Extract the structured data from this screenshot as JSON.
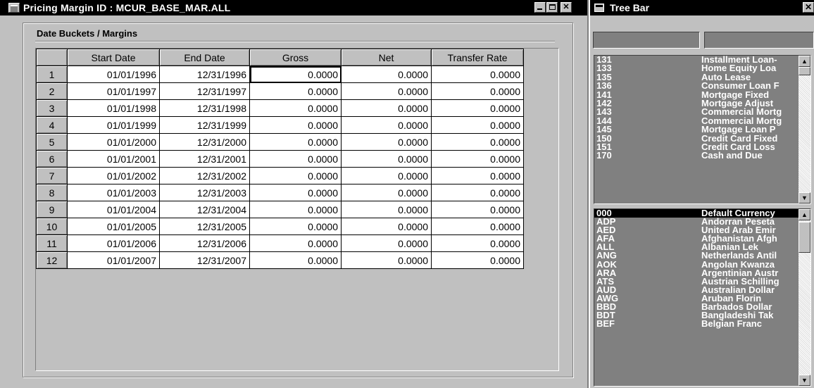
{
  "main_window": {
    "title": "Pricing Margin ID : MCUR_BASE_MAR.ALL",
    "group_label": "Date Buckets / Margins",
    "columns": [
      "",
      "Start Date",
      "End Date",
      "Gross",
      "Net",
      "Transfer Rate"
    ],
    "rows": [
      {
        "num": "1",
        "start": "01/01/1996",
        "end": "12/31/1996",
        "gross": "0.0000",
        "net": "0.0000",
        "rate": "0.0000"
      },
      {
        "num": "2",
        "start": "01/01/1997",
        "end": "12/31/1997",
        "gross": "0.0000",
        "net": "0.0000",
        "rate": "0.0000"
      },
      {
        "num": "3",
        "start": "01/01/1998",
        "end": "12/31/1998",
        "gross": "0.0000",
        "net": "0.0000",
        "rate": "0.0000"
      },
      {
        "num": "4",
        "start": "01/01/1999",
        "end": "12/31/1999",
        "gross": "0.0000",
        "net": "0.0000",
        "rate": "0.0000"
      },
      {
        "num": "5",
        "start": "01/01/2000",
        "end": "12/31/2000",
        "gross": "0.0000",
        "net": "0.0000",
        "rate": "0.0000"
      },
      {
        "num": "6",
        "start": "01/01/2001",
        "end": "12/31/2001",
        "gross": "0.0000",
        "net": "0.0000",
        "rate": "0.0000"
      },
      {
        "num": "7",
        "start": "01/01/2002",
        "end": "12/31/2002",
        "gross": "0.0000",
        "net": "0.0000",
        "rate": "0.0000"
      },
      {
        "num": "8",
        "start": "01/01/2003",
        "end": "12/31/2003",
        "gross": "0.0000",
        "net": "0.0000",
        "rate": "0.0000"
      },
      {
        "num": "9",
        "start": "01/01/2004",
        "end": "12/31/2004",
        "gross": "0.0000",
        "net": "0.0000",
        "rate": "0.0000"
      },
      {
        "num": "10",
        "start": "01/01/2005",
        "end": "12/31/2005",
        "gross": "0.0000",
        "net": "0.0000",
        "rate": "0.0000"
      },
      {
        "num": "11",
        "start": "01/01/2006",
        "end": "12/31/2006",
        "gross": "0.0000",
        "net": "0.0000",
        "rate": "0.0000"
      },
      {
        "num": "12",
        "start": "01/01/2007",
        "end": "12/31/2007",
        "gross": "0.0000",
        "net": "0.0000",
        "rate": "0.0000"
      }
    ]
  },
  "tree_bar": {
    "title": "Tree Bar",
    "products": [
      {
        "code": "131",
        "desc": "Installment Loan-"
      },
      {
        "code": "133",
        "desc": "Home Equity Loa"
      },
      {
        "code": "135",
        "desc": "Auto Lease"
      },
      {
        "code": "136",
        "desc": "Consumer Loan F"
      },
      {
        "code": "141",
        "desc": "Mortgage Fixed"
      },
      {
        "code": "142",
        "desc": "Mortgage  Adjust"
      },
      {
        "code": "143",
        "desc": "Commercial Mortg"
      },
      {
        "code": "144",
        "desc": "Commercial Mortg"
      },
      {
        "code": "145",
        "desc": "Mortgage Loan P"
      },
      {
        "code": "150",
        "desc": "Credit Card Fixed"
      },
      {
        "code": "151",
        "desc": "Credit Card Loss"
      },
      {
        "code": "170",
        "desc": "Cash and Due"
      }
    ],
    "currencies": [
      {
        "code": "000",
        "desc": "Default Currency",
        "selected": true
      },
      {
        "code": "ADP",
        "desc": "Andorran Peseta"
      },
      {
        "code": "AED",
        "desc": "United Arab Emir"
      },
      {
        "code": "AFA",
        "desc": "Afghanistan Afgh"
      },
      {
        "code": "ALL",
        "desc": "Albanian Lek"
      },
      {
        "code": "ANG",
        "desc": "Netherlands Antil"
      },
      {
        "code": "AOK",
        "desc": "Angolan Kwanza"
      },
      {
        "code": "ARA",
        "desc": "Argentinian Austr"
      },
      {
        "code": "ATS",
        "desc": "Austrian Schilling"
      },
      {
        "code": "AUD",
        "desc": "Australian Dollar"
      },
      {
        "code": "AWG",
        "desc": "Aruban Florin"
      },
      {
        "code": "BBD",
        "desc": "Barbados Dollar"
      },
      {
        "code": "BDT",
        "desc": "Bangladeshi Tak"
      },
      {
        "code": "BEF",
        "desc": "Belgian Franc"
      }
    ]
  },
  "icons": {
    "window_icon": "window-doc-icon",
    "minimize": "minimize-icon",
    "maximize": "maximize-icon",
    "close": "close-icon",
    "scroll_up": "arrow-up-icon",
    "scroll_down": "arrow-down-icon"
  },
  "colors": {
    "titlebar": "#000000",
    "face": "#c0c0c0",
    "list_bg": "#808080",
    "selection": "#000000"
  }
}
